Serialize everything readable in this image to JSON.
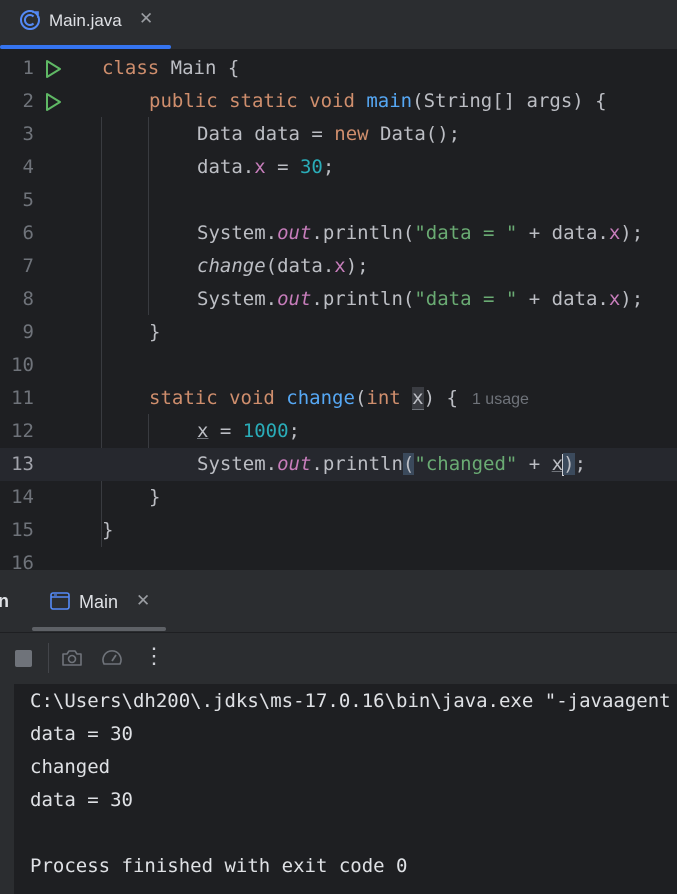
{
  "editor_tab": {
    "label": "Main.java",
    "close": "✕"
  },
  "gutter": [
    "1",
    "2",
    "3",
    "4",
    "5",
    "6",
    "7",
    "8",
    "9",
    "10",
    "11",
    "12",
    "13",
    "14",
    "15",
    "16"
  ],
  "code": {
    "l1": {
      "kw": "class",
      "rest": " Main {"
    },
    "l2": {
      "kw1": "public static void",
      "fn": "main",
      "rest": "(String[] args) {"
    },
    "l3": {
      "a": "Data data = ",
      "kw": "new",
      "b": " Data();"
    },
    "l4": {
      "a": "data.",
      "fld": "x",
      "b": " = ",
      "num": "30",
      "c": ";"
    },
    "l6": {
      "a": "System.",
      "st": "out",
      "b": ".println(",
      "str": "\"data = \"",
      "c": " + data.",
      "fld": "x",
      "d": ");"
    },
    "l7": {
      "fn": "change",
      "a": "(data.",
      "fld": "x",
      "b": ");"
    },
    "l8": {
      "a": "System.",
      "st": "out",
      "b": ".println(",
      "str": "\"data = \"",
      "c": " + data.",
      "fld": "x",
      "d": ");"
    },
    "l9": {
      "a": "}"
    },
    "l11": {
      "kw": "static void",
      "fn": "change",
      "a": "(",
      "kw2": "int",
      "param": "x",
      "b": ") {",
      "hint": "1 usage"
    },
    "l12": {
      "param": "x",
      "a": " = ",
      "num": "1000",
      "b": ";"
    },
    "l13": {
      "a": "System.",
      "st": "out",
      "b": ".println",
      "paren": "(",
      "str": "\"changed\"",
      "c": " + ",
      "param": "x",
      "paren2": ")",
      "d": ";"
    },
    "l14": {
      "a": "}"
    },
    "l15": {
      "a": "}"
    }
  },
  "run_panel": {
    "partial_tab": "n",
    "tab": {
      "label": "Main",
      "close": "✕"
    },
    "toolbar_more": "⋮"
  },
  "console": [
    "C:\\Users\\dh200\\.jdks\\ms-17.0.16\\bin\\java.exe \"-javaagent",
    "data = 30",
    "changed",
    "data = 30",
    "",
    "Process finished with exit code 0"
  ],
  "colors": {
    "accent": "#3574f0",
    "keyword": "#cf8e6d",
    "function": "#56a8f5",
    "string": "#6aab73",
    "number": "#2aacb8",
    "field": "#c77dbb",
    "run_icon": "#5fb865"
  }
}
